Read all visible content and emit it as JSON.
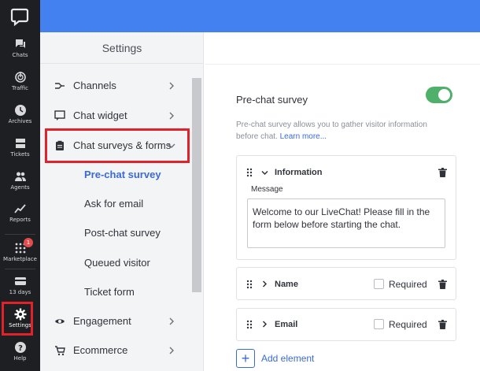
{
  "rail": {
    "items": [
      {
        "label": "Chats",
        "icon": "chats-icon"
      },
      {
        "label": "Traffic",
        "icon": "traffic-icon"
      },
      {
        "label": "Archives",
        "icon": "archives-icon"
      },
      {
        "label": "Tickets",
        "icon": "tickets-icon"
      },
      {
        "label": "Agents",
        "icon": "agents-icon"
      },
      {
        "label": "Reports",
        "icon": "reports-icon"
      },
      {
        "label": "Marketplace",
        "icon": "marketplace-icon",
        "badge": "1"
      },
      {
        "label": "13 days",
        "icon": "billing-icon"
      },
      {
        "label": "Settings",
        "icon": "gear-icon"
      },
      {
        "label": "Help",
        "icon": "help-icon"
      }
    ]
  },
  "settings": {
    "title": "Settings",
    "nav": [
      {
        "label": "Channels",
        "icon": "channels-icon"
      },
      {
        "label": "Chat widget",
        "icon": "chat-widget-icon"
      },
      {
        "label": "Chat surveys & forms",
        "icon": "clipboard-icon"
      },
      {
        "label": "Engagement",
        "icon": "eye-icon"
      },
      {
        "label": "Ecommerce",
        "icon": "cart-icon"
      }
    ],
    "subnav": [
      {
        "label": "Pre-chat survey",
        "active": true
      },
      {
        "label": "Ask for email"
      },
      {
        "label": "Post-chat survey"
      },
      {
        "label": "Queued visitor"
      },
      {
        "label": "Ticket form"
      }
    ]
  },
  "main": {
    "title": "Pre-chat survey",
    "toggle_on": true,
    "description": "Pre-chat survey allows you to gather visitor information before chat.",
    "learn_more": "Learn more...",
    "cards": [
      {
        "title": "Information",
        "expanded": true,
        "message_label": "Message",
        "message": "Welcome to our LiveChat! Please fill in the form below before starting the chat."
      },
      {
        "title": "Name",
        "required_label": "Required",
        "required": false
      },
      {
        "title": "Email",
        "required_label": "Required",
        "required": false
      }
    ],
    "add_element": "Add element"
  },
  "colors": {
    "rail_bg": "#1e1f22",
    "topbar": "#4380f0",
    "accent": "#3a6ad8",
    "toggle_on": "#4fb06b",
    "highlight": "#e0232b"
  }
}
